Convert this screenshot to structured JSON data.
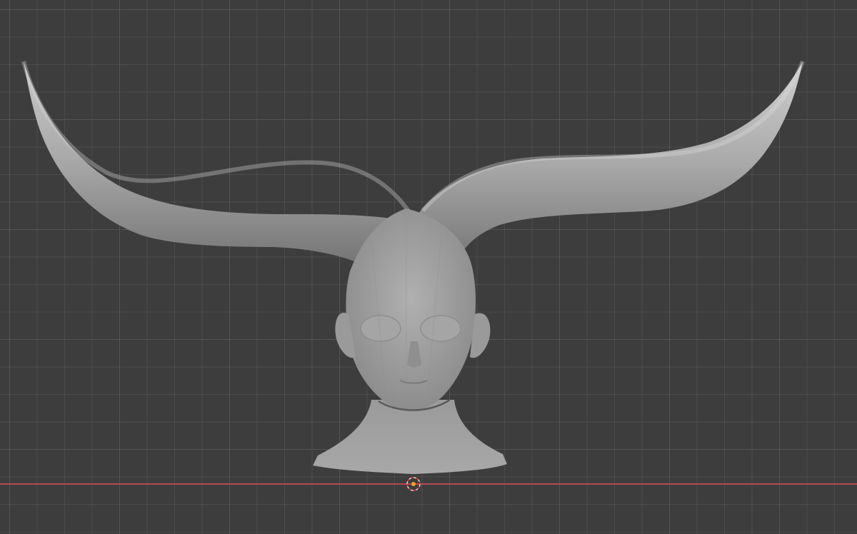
{
  "viewport": {
    "name": "3D Viewport",
    "grid": "visible",
    "axis_x_color": "#b34a52",
    "background_color": "#3d3d3d",
    "mesh_color": "#a8a8a8"
  },
  "scene": {
    "objects": [
      {
        "name": "horns",
        "icon": "horn-mesh"
      },
      {
        "name": "head",
        "icon": "head-mesh"
      }
    ],
    "cursor_icon": "3d-cursor-icon"
  }
}
